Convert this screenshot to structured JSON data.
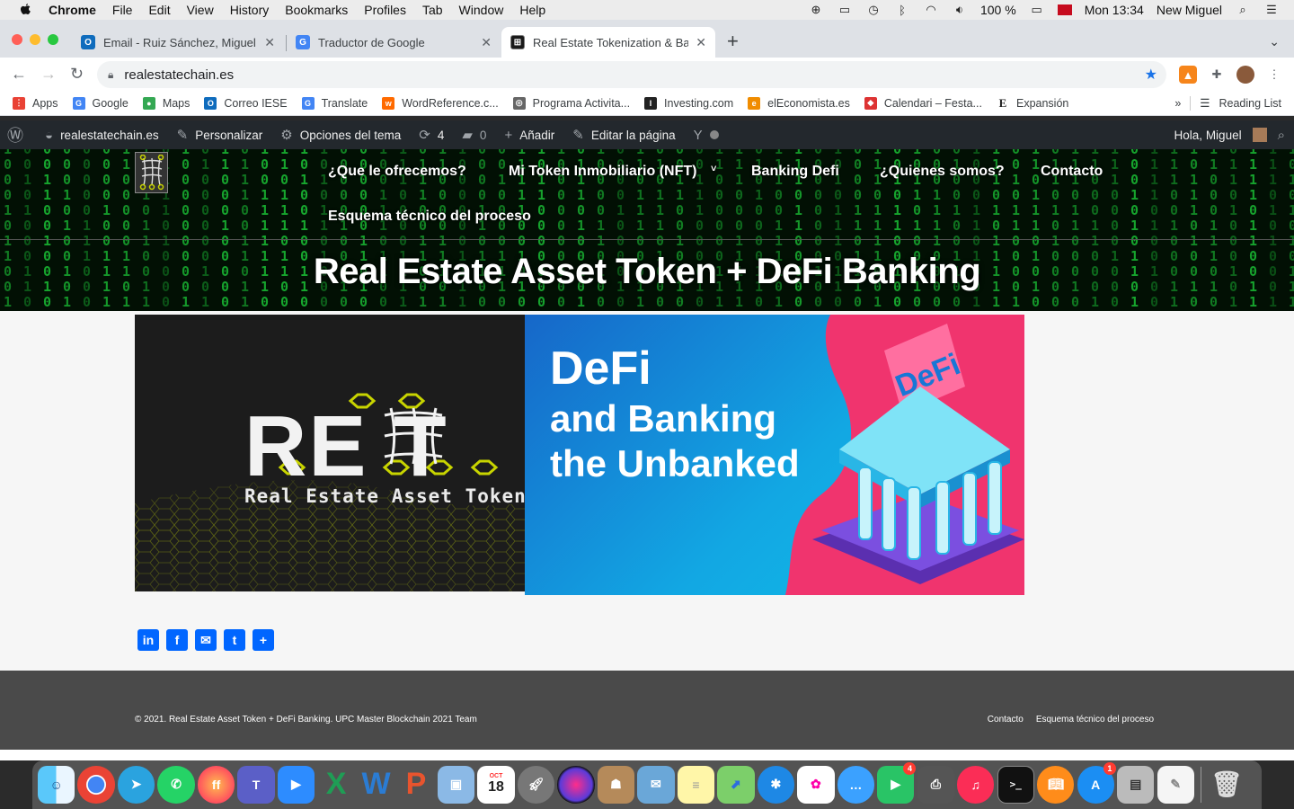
{
  "menubar": {
    "items": [
      "Chrome",
      "File",
      "Edit",
      "View",
      "History",
      "Bookmarks",
      "Profiles",
      "Tab",
      "Window",
      "Help"
    ],
    "battery": "100 %",
    "clock": "Mon 13:34",
    "user": "New Miguel"
  },
  "tabs": [
    {
      "title": "Email - Ruiz Sánchez, Miguel -",
      "favicon_color": "#0f6cbd"
    },
    {
      "title": "Traductor de Google",
      "favicon_color": "#4285f4"
    },
    {
      "title": "Real Estate Tokenization & Ban",
      "favicon_color": "#1a1a1a"
    }
  ],
  "address_bar": {
    "url": "realestatechain.es"
  },
  "bookmarks": [
    {
      "label": "Apps",
      "icon": "apps-grid-icon",
      "color": "#e94235"
    },
    {
      "label": "Google",
      "icon": "google-g-icon",
      "color": "#4285f4"
    },
    {
      "label": "Maps",
      "icon": "maps-pin-icon",
      "color": "#34a853"
    },
    {
      "label": "Correo IESE",
      "icon": "outlook-icon",
      "color": "#0f6cbd"
    },
    {
      "label": "Translate",
      "icon": "translate-icon",
      "color": "#4285f4"
    },
    {
      "label": "WordReference.c...",
      "icon": "wordreference-icon",
      "color": "#ff6a00"
    },
    {
      "label": "Programa Activita...",
      "icon": "program-icon",
      "color": "#666666"
    },
    {
      "label": "Investing.com",
      "icon": "investing-icon",
      "color": "#222222"
    },
    {
      "label": "elEconomista.es",
      "icon": "eleconomista-icon",
      "color": "#f08c00"
    },
    {
      "label": "Calendari – Festa...",
      "icon": "calendar-icon",
      "color": "#dd3333"
    },
    {
      "label": "Expansión",
      "icon": "expansion-icon",
      "color": "#222222"
    }
  ],
  "reading_list": "Reading List",
  "wp_admin": {
    "site": "realestatechain.es",
    "customize": "Personalizar",
    "theme_options": "Opciones del tema",
    "updates": "4",
    "comments": "0",
    "add_new": "Añadir",
    "edit_page": "Editar la página",
    "greeting": "Hola, Miguel"
  },
  "site": {
    "nav": [
      "¿Que le ofrecemos?",
      "Mi Token Inmobiliario (NFT)",
      "Banking Defi",
      "¿Quienes somos?",
      "Contacto",
      "Esquema técnico del proceso"
    ],
    "title": "Real Estate Asset Token + DeFi Banking"
  },
  "cards": {
    "reat_letters": "RE  T",
    "reat_sub": "Real Estate Asset Token",
    "defi_l1": "DeFi",
    "defi_l2": "and Banking",
    "defi_l3": "the Unbanked",
    "defi_badge": "DeFi"
  },
  "footer": {
    "copyright": "© 2021. Real Estate Asset Token + DeFi Banking. UPC Master Blockchain 2021 Team",
    "links": [
      "Contacto",
      "Esquema técnico del proceso"
    ]
  },
  "dock": {
    "calendar_month": "OCT",
    "calendar_day": "18",
    "facetime_badge": "4",
    "appstore_badge": "1"
  }
}
